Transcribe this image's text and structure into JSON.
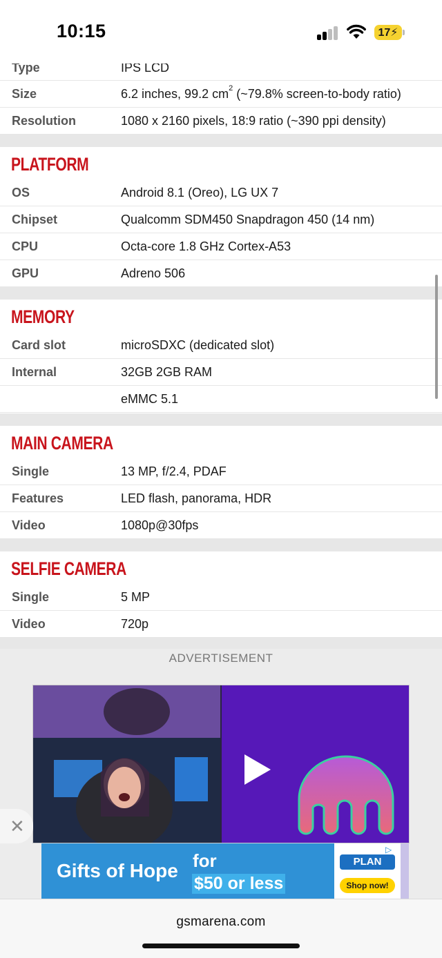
{
  "status_bar": {
    "time": "10:15",
    "battery_percent": "17",
    "battery_color": "#f5d230"
  },
  "spec_rows_top": [
    {
      "label": "Type",
      "value": "IPS LCD"
    },
    {
      "label": "Size",
      "value": "6.2 inches, 99.2 cm",
      "sup": "2",
      "value_after": " (~79.8% screen-to-body ratio)"
    },
    {
      "label": "Resolution",
      "value": "1080 x 2160 pixels, 18:9 ratio (~390 ppi density)"
    }
  ],
  "sections": [
    {
      "title": "PLATFORM",
      "rows": [
        {
          "label": "OS",
          "value": "Android 8.1 (Oreo), LG UX 7"
        },
        {
          "label": "Chipset",
          "value": "Qualcomm SDM450 Snapdragon 450 (14 nm)"
        },
        {
          "label": "CPU",
          "value": "Octa-core 1.8 GHz Cortex-A53"
        },
        {
          "label": "GPU",
          "value": "Adreno 506"
        }
      ]
    },
    {
      "title": "MEMORY",
      "rows": [
        {
          "label": "Card slot",
          "value": "microSDXC (dedicated slot)"
        },
        {
          "label": "Internal",
          "value": "32GB 2GB RAM"
        },
        {
          "label": "",
          "value": "eMMC 5.1"
        }
      ]
    },
    {
      "title": "MAIN CAMERA",
      "rows": [
        {
          "label": "Single",
          "value": "13 MP, f/2.4, PDAF"
        },
        {
          "label": "Features",
          "value": "LED flash, panorama, HDR"
        },
        {
          "label": "Video",
          "value": "1080p@30fps"
        }
      ]
    },
    {
      "title": "SELFIE CAMERA",
      "rows": [
        {
          "label": "Single",
          "value": "5 MP"
        },
        {
          "label": "Video",
          "value": "720p"
        }
      ]
    }
  ],
  "section_title_color": "#c8141c",
  "advertisement": {
    "label": "ADVERTISEMENT",
    "play_icon": "play-icon",
    "close_icon": "close-icon",
    "close_symbol": "✕"
  },
  "banner": {
    "headline": "Gifts of Hope",
    "for_text": "for",
    "price_text": "$50 or less",
    "brand": "PLAN",
    "cta": "Shop now!",
    "adchoices_icon": "adchoices-icon"
  },
  "browser": {
    "url": "gsmarena.com"
  }
}
